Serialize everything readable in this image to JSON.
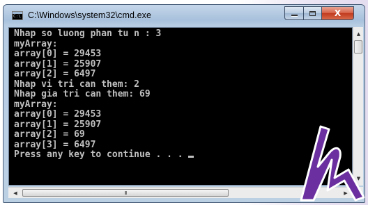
{
  "window": {
    "title": "C:\\Windows\\system32\\cmd.exe",
    "icon": "cmd-icon",
    "icon_text": "C:\\"
  },
  "controls": {
    "minimize": "minimize-icon",
    "maximize": "maximize-icon",
    "close_label": "X"
  },
  "console": {
    "lines": [
      "Nhap so luong phan tu n : 3",
      "myArray:",
      "array[0] = 29453",
      "array[1] = 25907",
      "array[2] = 6497",
      "Nhap vi tri can them: 2",
      "Nhap gia tri can them: 69",
      "myArray:",
      "array[0] = 29453",
      "array[1] = 25907",
      "array[2] = 69",
      "array[3] = 6497",
      "Press any key to continue . . . "
    ],
    "text_color": "#c0c0c0",
    "background": "#000000"
  },
  "scrollbars": {
    "up": "▲",
    "down": "▼",
    "left": "◀",
    "right": "▶",
    "thumb_grip": "III"
  },
  "logo": {
    "name": "h-logo",
    "color": "#6b2fa0"
  }
}
